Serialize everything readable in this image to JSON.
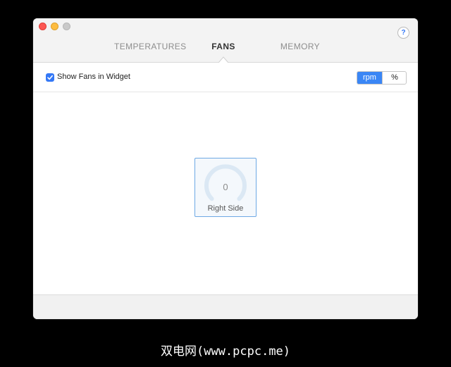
{
  "tabs": [
    {
      "label": "TEMPERATURES",
      "selected": false
    },
    {
      "label": "FANS",
      "selected": true
    },
    {
      "label": "MEMORY",
      "selected": false
    }
  ],
  "help": {
    "label": "?"
  },
  "toolbar": {
    "show_fans_label": "Show Fans in Widget",
    "show_fans_checked": true,
    "units": [
      {
        "label": "rpm",
        "selected": true
      },
      {
        "label": "%",
        "selected": false
      }
    ]
  },
  "fans": [
    {
      "name": "Right Side",
      "value": "0",
      "level": 0
    }
  ],
  "watermark": "双电网(www.pcpc.me)",
  "colors": {
    "accent": "#3a86f5",
    "card_border": "#6ea9e4",
    "gauge_track": "#dbe8f4"
  }
}
